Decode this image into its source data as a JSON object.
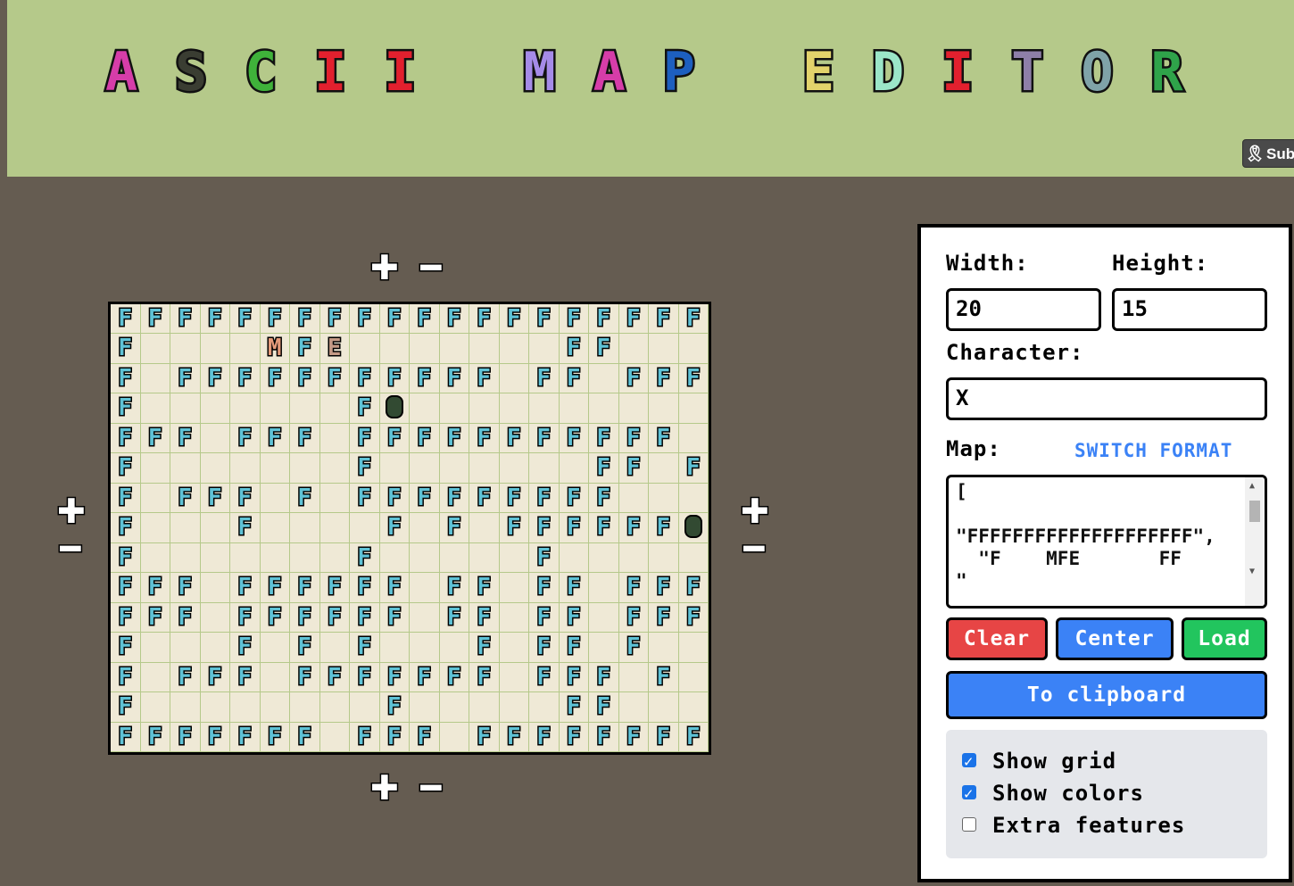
{
  "header": {
    "title_letters": [
      {
        "ch": "A",
        "color": "#d63da9"
      },
      {
        "ch": "S",
        "color": "#3a3d32"
      },
      {
        "ch": "C",
        "color": "#3fb23a"
      },
      {
        "ch": "I",
        "color": "#e2202e"
      },
      {
        "ch": "I",
        "color": "#e2202e"
      },
      {
        "ch": "M",
        "color": "#a58be8"
      },
      {
        "ch": "A",
        "color": "#d63da9"
      },
      {
        "ch": "P",
        "color": "#1d5fbf"
      },
      {
        "ch": "E",
        "color": "#e3d36b"
      },
      {
        "ch": "D",
        "color": "#9be6c8"
      },
      {
        "ch": "I",
        "color": "#e2202e"
      },
      {
        "ch": "T",
        "color": "#8e7fa8"
      },
      {
        "ch": "O",
        "color": "#7fa3a8"
      },
      {
        "ch": "R",
        "color": "#2fa34a"
      }
    ],
    "subscribe_label": "Sub",
    "subscribe_icon": "award-icon"
  },
  "controls": {
    "plus": "✚",
    "minus": "━"
  },
  "grid": {
    "width": 20,
    "height": 15,
    "rows": [
      "FFFFFFFFFFFFFFFFFFFF",
      "F    MFE       FF   ",
      "F FFFFFFFFFFF FF FFF",
      "F       FO          ",
      "FFF FFF FFFFFFFFFFF ",
      "F       F       FF F ",
      "F FFF F FFFFFFFFF   ",
      "F   F    F F FFFFFFO",
      "F       F     F     ",
      "FFF FFFFFF FF FF FFF",
      "FFF FFFFFF FF FF FFF",
      "F   F F F   F FF F  ",
      "F FFF FFFFFFF FFF F ",
      "F        F     FF   ",
      "FFFFFFF FFF FFFFFFFF"
    ],
    "char_colors": {
      "F": "#5fc2d6",
      "M": "#e59a7a",
      "E": "#c49a86",
      "O": "#324a32"
    }
  },
  "panel": {
    "width_label": "Width:",
    "height_label": "Height:",
    "width_value": "20",
    "height_value": "15",
    "character_label": "Character:",
    "character_value": "X",
    "map_label": "Map:",
    "switch_format": "SWITCH FORMAT",
    "map_text": "[\n\n\"FFFFFFFFFFFFFFFFFFFF\",\n  \"F    MFE       FF  \n\"",
    "buttons": {
      "clear": "Clear",
      "center": "Center",
      "load": "Load",
      "clipboard": "To clipboard"
    },
    "button_colors": {
      "clear": "#e74545",
      "center": "#3b82f6",
      "load": "#22c55e",
      "clipboard": "#3b82f6"
    },
    "options": [
      {
        "label": "Show grid",
        "checked": true
      },
      {
        "label": "Show colors",
        "checked": true
      },
      {
        "label": "Extra features",
        "checked": false
      }
    ]
  }
}
